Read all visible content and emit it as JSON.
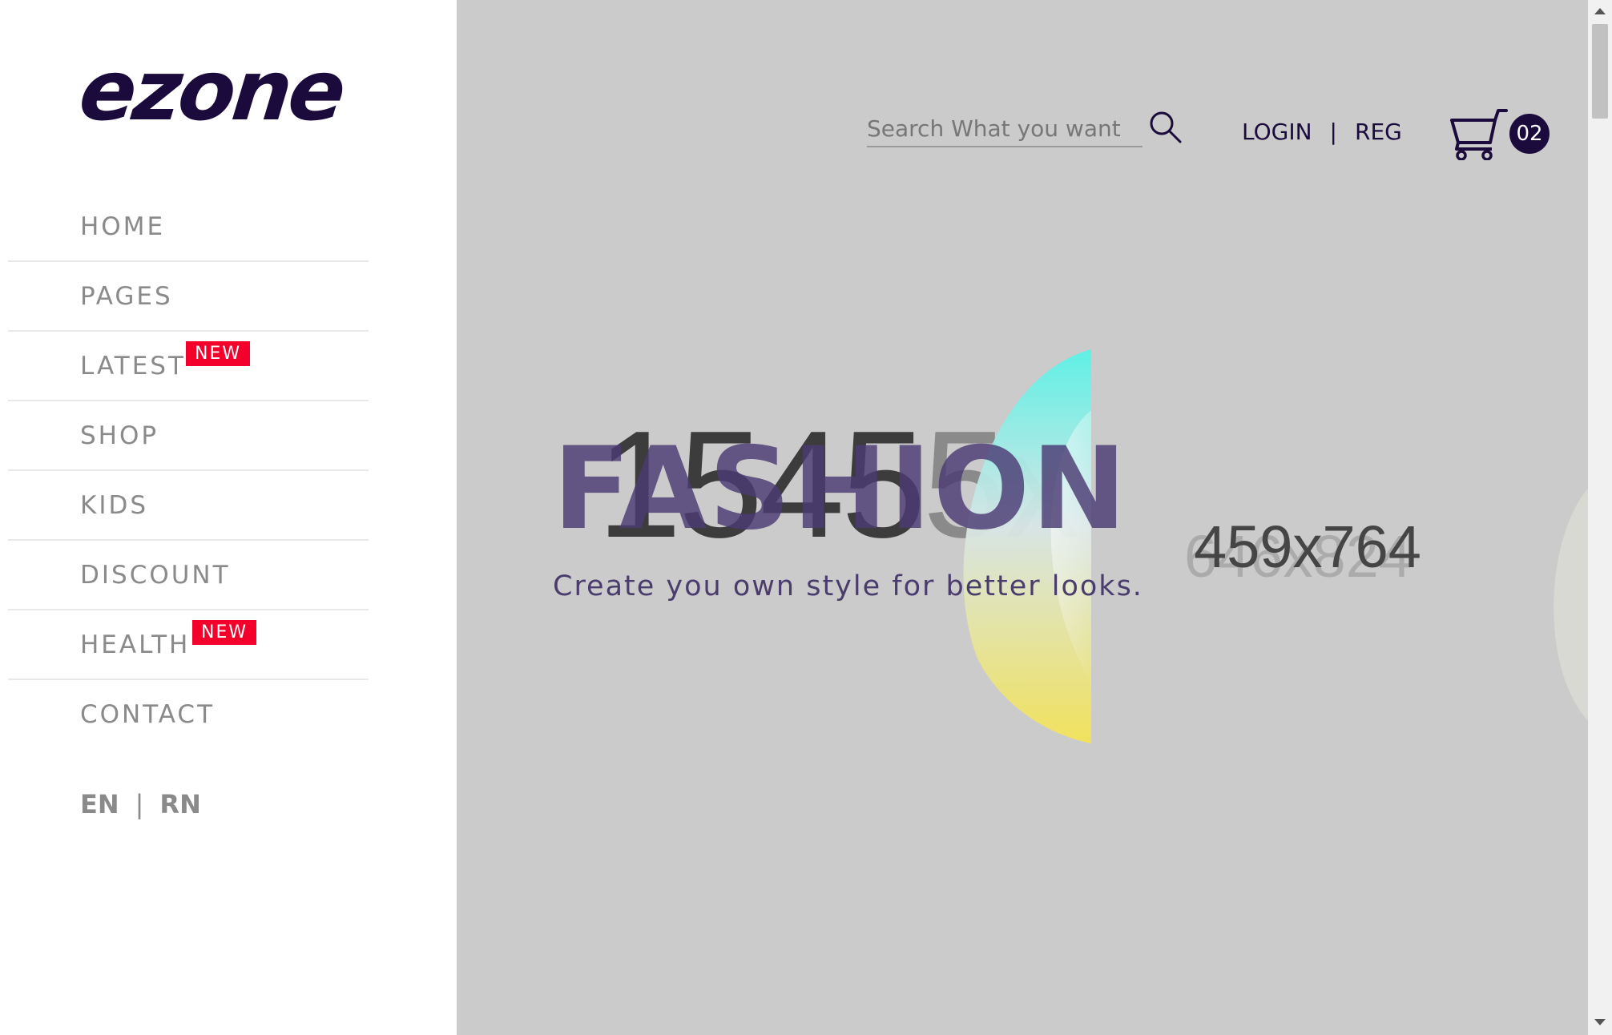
{
  "brand": {
    "logo_text": "ezone",
    "color": "#1b0b3d"
  },
  "sidebar": {
    "nav_items": [
      {
        "label": "HOME"
      },
      {
        "label": "PAGES"
      },
      {
        "label": "LATEST",
        "badge": "NEW"
      },
      {
        "label": "SHOP"
      },
      {
        "label": "KIDS"
      },
      {
        "label": "DISCOUNT"
      },
      {
        "label": "HEALTH",
        "badge": "NEW"
      },
      {
        "label": "CONTACT"
      }
    ],
    "languages": [
      "EN",
      "RN"
    ],
    "language_separator": "|"
  },
  "header": {
    "search": {
      "placeholder": "Search What you want",
      "icon": "search-icon"
    },
    "auth": {
      "login": "LOGIN",
      "separator": "|",
      "register": "REG"
    },
    "cart": {
      "icon": "cart-icon",
      "count": "02"
    }
  },
  "hero": {
    "title": "FASHION",
    "subtitle": "Create you own style for better looks.",
    "placeholder_main": "1545",
    "placeholder_main_faded": "5x",
    "placeholder_right": "459x764",
    "placeholder_right_ghost": "646x824"
  },
  "colors": {
    "badge_new": "#f3002b",
    "main_background": "#cbcbcb",
    "nav_text": "#8a8a8a",
    "hero_title": "#4b3a73"
  }
}
